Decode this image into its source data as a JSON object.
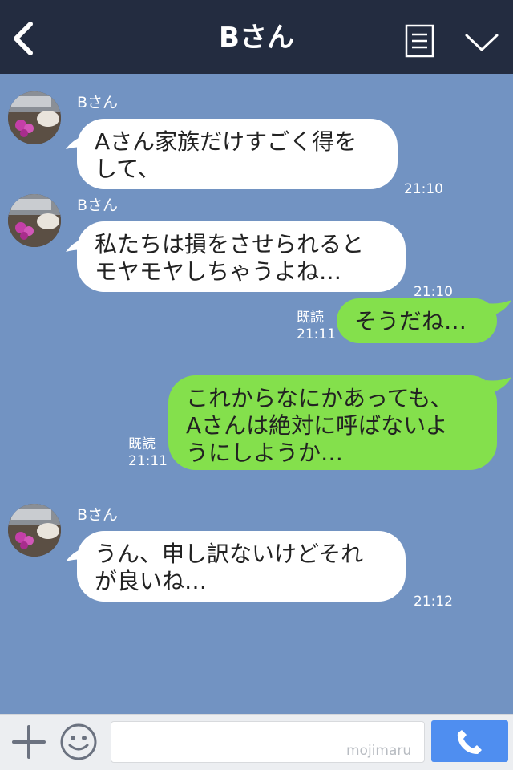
{
  "header": {
    "title": "Bさん",
    "back_icon": "chevron-left-icon",
    "menu_icon": "document-list-icon",
    "dropdown_icon": "chevron-down-icon",
    "bg_color": "#232c40"
  },
  "colors": {
    "chat_bg": "#7293c2",
    "left_bubble": "#ffffff",
    "right_bubble": "#84e04c",
    "send_button": "#4f8ef0"
  },
  "messages": [
    {
      "side": "left",
      "sender": "Bさん",
      "text": "Aさん家族だけすごく得を\nして、",
      "time": "21:10"
    },
    {
      "side": "left",
      "sender": "Bさん",
      "text": "私たちは損をさせられると\nモヤモヤしちゃうよね…",
      "time": "21:10"
    },
    {
      "side": "right",
      "read": "既読",
      "text": "そうだね…",
      "time": "21:11"
    },
    {
      "side": "right",
      "read": "既読",
      "text": "これからなにかあっても、\nAさんは絶対に呼ばないよ\nうにしようか…",
      "time": "21:11"
    },
    {
      "side": "left",
      "sender": "Bさん",
      "text": "うん、申し訳ないけどそれ\nが良いね…",
      "time": "21:12"
    }
  ],
  "inputbar": {
    "plus_icon": "plus-icon",
    "emoji_icon": "smiley-icon",
    "input_value": "",
    "watermark": "mojimaru",
    "call_icon": "phone-icon"
  }
}
